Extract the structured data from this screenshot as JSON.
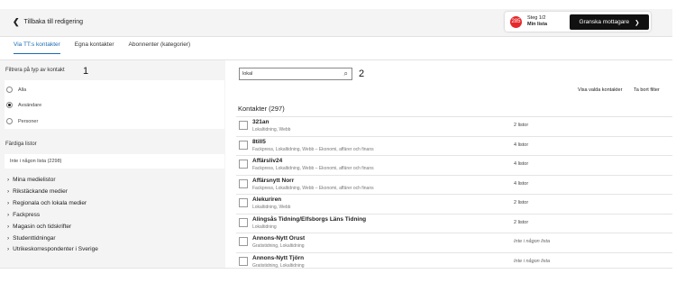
{
  "header": {
    "back_label": "Tillbaka till redigering",
    "badge_count": "285",
    "step_label": "Steg 1/2",
    "step_sub": "Min lista",
    "review_label": "Granska mottagare"
  },
  "tabs": [
    "Via TT:s kontakter",
    "Egna kontakter",
    "Abonnenter (kategorier)"
  ],
  "annotations": {
    "one": "1",
    "two": "2"
  },
  "filter": {
    "title": "Filtrera på typ av kontakt",
    "options": [
      "Alla",
      "Avsändare",
      "Personer"
    ],
    "selected": 1
  },
  "ready": {
    "title": "Färdiga listor",
    "value": "Inte i någon lista (2298)"
  },
  "categories": [
    "Mina medielistor",
    "Rikstäckande medier",
    "Regionala och lokala medier",
    "Fackpress",
    "Magasin och tidskrifter",
    "Studenttidningar",
    "Utrikeskorrespondenter i Sverige"
  ],
  "search": {
    "value": "lokal"
  },
  "links": {
    "show_selected": "Visa valda kontakter",
    "clear_filter": "Ta bort filter"
  },
  "contacts_title": "Kontakter (297)",
  "contacts": [
    {
      "name": "321an",
      "sub": "Lokaltidning, Webb",
      "lists": "2 listor"
    },
    {
      "name": "8till5",
      "sub": "Fackpress, Lokaltidning, Webb – Ekonomi, affärer och finans",
      "lists": "4 listor"
    },
    {
      "name": "Affärsliv24",
      "sub": "Fackpress, Lokaltidning, Webb – Ekonomi, affärer och finans",
      "lists": "4 listor"
    },
    {
      "name": "Affärsnytt Norr",
      "sub": "Fackpress, Lokaltidning, Webb – Ekonomi, affärer och finans",
      "lists": "4 listor"
    },
    {
      "name": "Alekuriren",
      "sub": "Lokaltidning, Webb",
      "lists": "2 listor"
    },
    {
      "name": "Alingsås Tidning/Elfsborgs Läns Tidning",
      "sub": "Lokaltidning",
      "lists": "2 listor"
    },
    {
      "name": "Annons-Nytt Orust",
      "sub": "Gratistidning, Lokaltidning",
      "lists": "Inte i någon lista"
    },
    {
      "name": "Annons-Nytt Tjörn",
      "sub": "Gratistidning, Lokaltidning",
      "lists": "Inte i någon lista"
    }
  ]
}
